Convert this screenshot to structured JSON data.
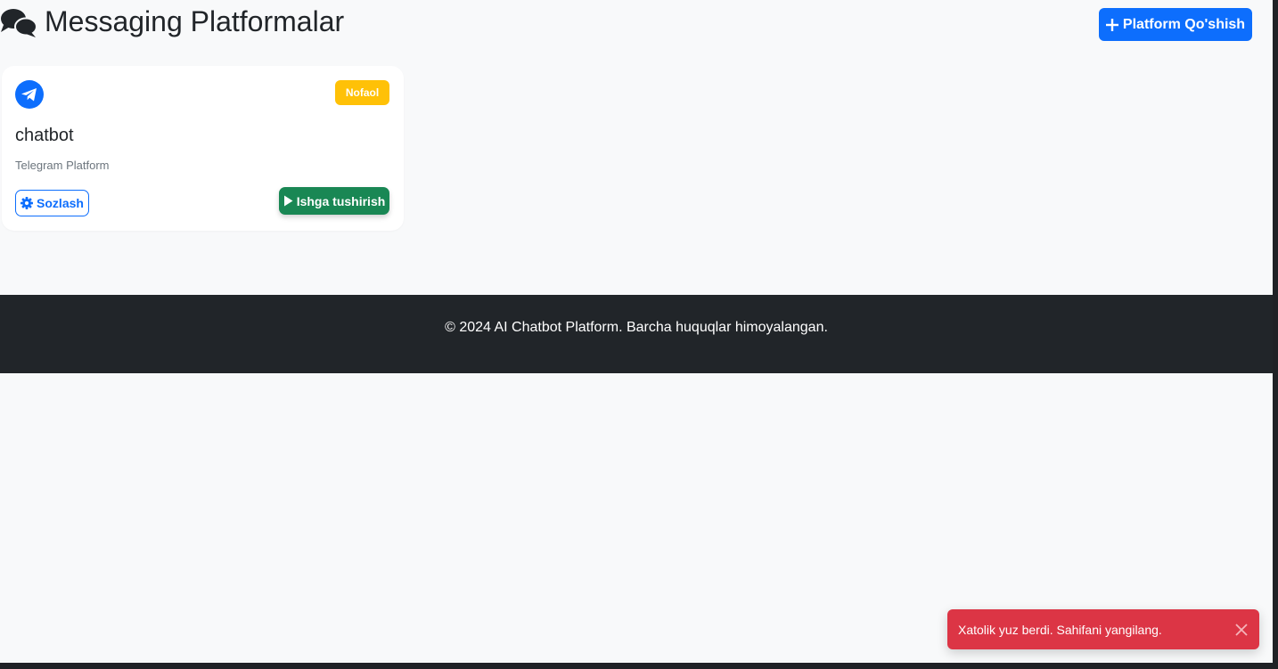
{
  "header": {
    "title": "Messaging Platformalar",
    "title_icon": "comments-icon",
    "add_button_label": "Platform Qo'shish",
    "add_button_icon": "plus-icon"
  },
  "platforms": [
    {
      "icon": "telegram-icon",
      "status": "Nofaol",
      "name": "chatbot",
      "type": "Telegram Platform",
      "settings_label": "Sozlash",
      "settings_icon": "gear-icon",
      "start_label": "Ishga tushirish",
      "start_icon": "play-icon"
    }
  ],
  "footer": {
    "text": "© 2024 AI Chatbot Platform. Barcha huquqlar himoyalangan."
  },
  "toast": {
    "message": "Xatolik yuz berdi. Sahifani yangilang.",
    "close_icon": "close-icon"
  },
  "colors": {
    "primary": "#0d6efd",
    "success": "#198754",
    "warning": "#ffc107",
    "danger": "#dc3545",
    "dark": "#212529",
    "background": "#f8f9fa"
  }
}
